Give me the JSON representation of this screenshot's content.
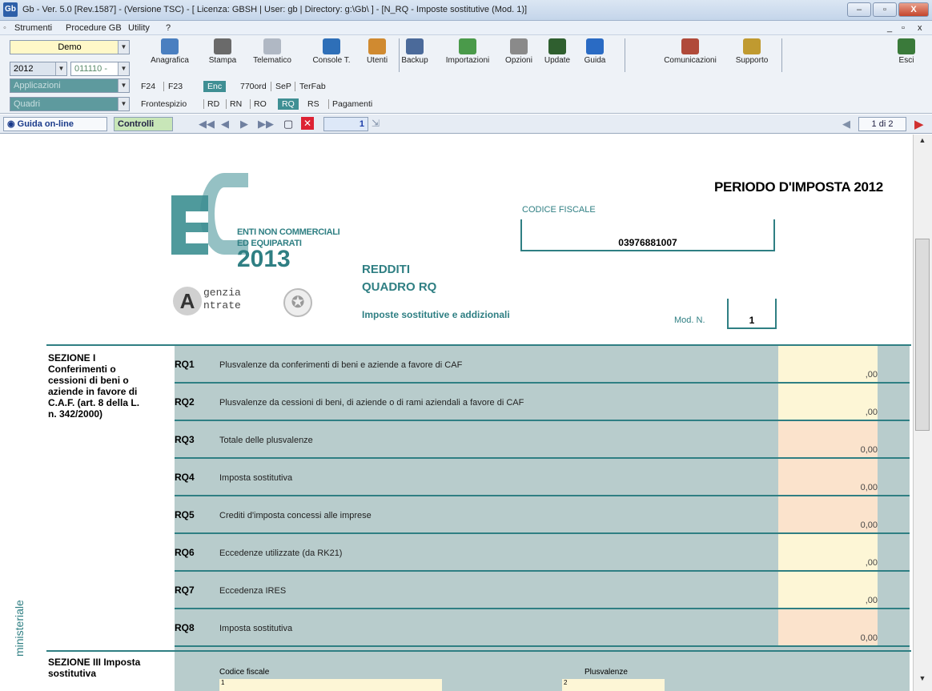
{
  "window": {
    "title": "Gb - Ver. 5.0 [Rev.1587] - (Versione TSC) - [ Licenza: GBSH | User: gb | Directory: g:\\Gb\\ ] - [N_RQ - Imposte sostitutive (Mod. 1)]",
    "app_icon": "Gb",
    "min": "–",
    "max": "▫",
    "close": "X"
  },
  "menu": {
    "items": [
      "Strumenti",
      "Procedure GB",
      "Utility",
      "?"
    ],
    "doc_controls": [
      "_",
      "▫",
      "x"
    ]
  },
  "selectors": {
    "company": "Demo",
    "year": "2012",
    "code": "011110 -",
    "applicazioni": "Applicazioni",
    "quadri": "Quadri"
  },
  "toolbar": {
    "buttons": [
      {
        "label": "Anagrafica",
        "icon": "address-book-icon",
        "color": "#4a7fc0"
      },
      {
        "label": "Stampa",
        "icon": "printer-icon",
        "color": "#6a6a6a"
      },
      {
        "label": "Telematico",
        "icon": "telematico-icon",
        "color": "#b0b8c4"
      },
      {
        "label": "Console T.",
        "icon": "console-icon",
        "color": "#2e6fb8"
      },
      {
        "label": "Utenti",
        "icon": "users-icon",
        "color": "#d08a30"
      },
      {
        "label": "Backup",
        "icon": "backup-icon",
        "color": "#4b6a9a"
      },
      {
        "label": "Importazioni",
        "icon": "import-icon",
        "color": "#4a9a4a"
      },
      {
        "label": "Opzioni",
        "icon": "wrench-icon",
        "color": "#8a8a8a"
      },
      {
        "label": "Update",
        "icon": "update-icon",
        "color": "#2f5f2f"
      },
      {
        "label": "Guida",
        "icon": "help-icon",
        "color": "#2a6bc4"
      },
      {
        "label": "Comunicazioni",
        "icon": "comunicazioni-icon",
        "color": "#b04a3a"
      },
      {
        "label": "Supporto",
        "icon": "supporto-icon",
        "color": "#c09a30"
      },
      {
        "label": "Esci",
        "icon": "exit-icon",
        "color": "#3a7a3a"
      }
    ]
  },
  "tabs1": {
    "items": [
      "F24",
      "F23",
      "Enc",
      "770ord",
      "SeP",
      "TerFab"
    ],
    "selected": "Enc"
  },
  "tabs2": {
    "items": [
      "Frontespizio",
      "RD",
      "RN",
      "RO",
      "RQ",
      "RS",
      "Pagamenti"
    ],
    "selected": "RQ"
  },
  "navbar": {
    "guida": "Guida on-line",
    "controlli": "Controlli",
    "page_num": "1",
    "page_of": "1 di 2"
  },
  "form": {
    "period": "PERIODO D'IMPOSTA 2012",
    "logo_lines": [
      "ENTI NON COMMERCIALI",
      "ED EQUIPARATI",
      "2013"
    ],
    "agenzia": [
      "genzia",
      "ntrate"
    ],
    "redditi": "REDDITI",
    "quadro": "QUADRO RQ",
    "subtitle": "Imposte sostitutive e addizionali",
    "cf_label": "CODICE FISCALE",
    "cf_value": "03976881007",
    "mod_label": "Mod. N.",
    "mod_value": "1",
    "section1": "SEZIONE I Conferimenti o cessioni di beni o aziende in favore di C.A.F. (art. 8 della L. n. 342/2000)",
    "section3": "SEZIONE III Imposta sostitutiva",
    "side_label": "ministeriale",
    "rows": [
      {
        "code": "RQ1",
        "desc": "Plusvalenze da conferimenti di beni e aziende a favore di CAF",
        "amount": ",00"
      },
      {
        "code": "RQ2",
        "desc": "Plusvalenze da cessioni di beni, di aziende o di rami aziendali a favore di CAF",
        "amount": ",00"
      },
      {
        "code": "RQ3",
        "desc": "Totale delle plusvalenze",
        "amount": "0,00"
      },
      {
        "code": "RQ4",
        "desc": "Imposta sostitutiva",
        "amount": "0,00"
      },
      {
        "code": "RQ5",
        "desc": "Crediti d'imposta concessi alle imprese",
        "amount": "0,00"
      },
      {
        "code": "RQ6",
        "desc": "Eccedenze utilizzate (da RK21)",
        "amount": ",00"
      },
      {
        "code": "RQ7",
        "desc": "Eccedenza IRES",
        "amount": ",00"
      },
      {
        "code": "RQ8",
        "desc": "Imposta sostitutiva",
        "amount": "0,00"
      }
    ],
    "sec3_col1": "Codice fiscale",
    "sec3_col2": "Plusvalenze",
    "sec3_n1": "1",
    "sec3_n2": "2"
  },
  "colors": {
    "teal": "#2f7f83",
    "section_bg": "#b8cccc",
    "amount_yellow": "#fdf6d6",
    "amount_peach": "#fbe3cc",
    "logo_teal": "#3f8f94"
  }
}
